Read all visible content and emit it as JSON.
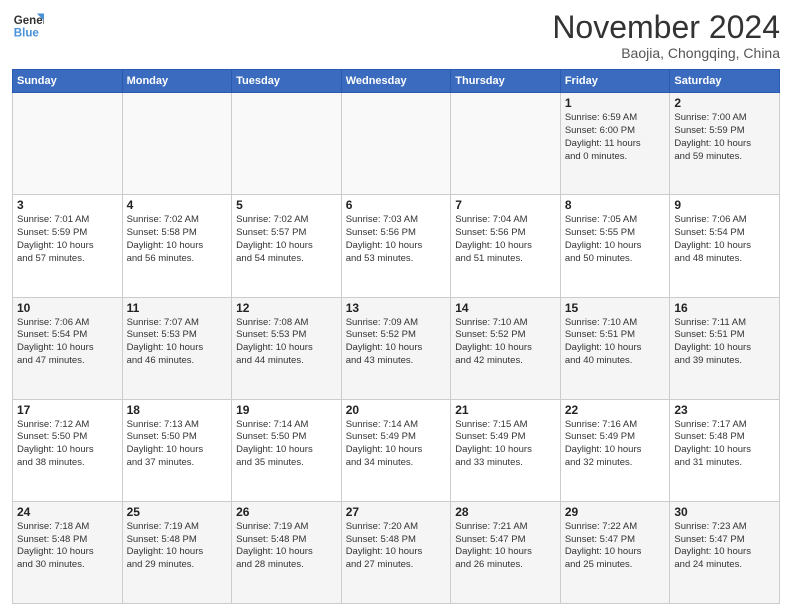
{
  "header": {
    "logo_line1": "General",
    "logo_line2": "Blue",
    "month": "November 2024",
    "location": "Baojia, Chongqing, China"
  },
  "weekdays": [
    "Sunday",
    "Monday",
    "Tuesday",
    "Wednesday",
    "Thursday",
    "Friday",
    "Saturday"
  ],
  "weeks": [
    [
      {
        "day": "",
        "detail": ""
      },
      {
        "day": "",
        "detail": ""
      },
      {
        "day": "",
        "detail": ""
      },
      {
        "day": "",
        "detail": ""
      },
      {
        "day": "",
        "detail": ""
      },
      {
        "day": "1",
        "detail": "Sunrise: 6:59 AM\nSunset: 6:00 PM\nDaylight: 11 hours\nand 0 minutes."
      },
      {
        "day": "2",
        "detail": "Sunrise: 7:00 AM\nSunset: 5:59 PM\nDaylight: 10 hours\nand 59 minutes."
      }
    ],
    [
      {
        "day": "3",
        "detail": "Sunrise: 7:01 AM\nSunset: 5:59 PM\nDaylight: 10 hours\nand 57 minutes."
      },
      {
        "day": "4",
        "detail": "Sunrise: 7:02 AM\nSunset: 5:58 PM\nDaylight: 10 hours\nand 56 minutes."
      },
      {
        "day": "5",
        "detail": "Sunrise: 7:02 AM\nSunset: 5:57 PM\nDaylight: 10 hours\nand 54 minutes."
      },
      {
        "day": "6",
        "detail": "Sunrise: 7:03 AM\nSunset: 5:56 PM\nDaylight: 10 hours\nand 53 minutes."
      },
      {
        "day": "7",
        "detail": "Sunrise: 7:04 AM\nSunset: 5:56 PM\nDaylight: 10 hours\nand 51 minutes."
      },
      {
        "day": "8",
        "detail": "Sunrise: 7:05 AM\nSunset: 5:55 PM\nDaylight: 10 hours\nand 50 minutes."
      },
      {
        "day": "9",
        "detail": "Sunrise: 7:06 AM\nSunset: 5:54 PM\nDaylight: 10 hours\nand 48 minutes."
      }
    ],
    [
      {
        "day": "10",
        "detail": "Sunrise: 7:06 AM\nSunset: 5:54 PM\nDaylight: 10 hours\nand 47 minutes."
      },
      {
        "day": "11",
        "detail": "Sunrise: 7:07 AM\nSunset: 5:53 PM\nDaylight: 10 hours\nand 46 minutes."
      },
      {
        "day": "12",
        "detail": "Sunrise: 7:08 AM\nSunset: 5:53 PM\nDaylight: 10 hours\nand 44 minutes."
      },
      {
        "day": "13",
        "detail": "Sunrise: 7:09 AM\nSunset: 5:52 PM\nDaylight: 10 hours\nand 43 minutes."
      },
      {
        "day": "14",
        "detail": "Sunrise: 7:10 AM\nSunset: 5:52 PM\nDaylight: 10 hours\nand 42 minutes."
      },
      {
        "day": "15",
        "detail": "Sunrise: 7:10 AM\nSunset: 5:51 PM\nDaylight: 10 hours\nand 40 minutes."
      },
      {
        "day": "16",
        "detail": "Sunrise: 7:11 AM\nSunset: 5:51 PM\nDaylight: 10 hours\nand 39 minutes."
      }
    ],
    [
      {
        "day": "17",
        "detail": "Sunrise: 7:12 AM\nSunset: 5:50 PM\nDaylight: 10 hours\nand 38 minutes."
      },
      {
        "day": "18",
        "detail": "Sunrise: 7:13 AM\nSunset: 5:50 PM\nDaylight: 10 hours\nand 37 minutes."
      },
      {
        "day": "19",
        "detail": "Sunrise: 7:14 AM\nSunset: 5:50 PM\nDaylight: 10 hours\nand 35 minutes."
      },
      {
        "day": "20",
        "detail": "Sunrise: 7:14 AM\nSunset: 5:49 PM\nDaylight: 10 hours\nand 34 minutes."
      },
      {
        "day": "21",
        "detail": "Sunrise: 7:15 AM\nSunset: 5:49 PM\nDaylight: 10 hours\nand 33 minutes."
      },
      {
        "day": "22",
        "detail": "Sunrise: 7:16 AM\nSunset: 5:49 PM\nDaylight: 10 hours\nand 32 minutes."
      },
      {
        "day": "23",
        "detail": "Sunrise: 7:17 AM\nSunset: 5:48 PM\nDaylight: 10 hours\nand 31 minutes."
      }
    ],
    [
      {
        "day": "24",
        "detail": "Sunrise: 7:18 AM\nSunset: 5:48 PM\nDaylight: 10 hours\nand 30 minutes."
      },
      {
        "day": "25",
        "detail": "Sunrise: 7:19 AM\nSunset: 5:48 PM\nDaylight: 10 hours\nand 29 minutes."
      },
      {
        "day": "26",
        "detail": "Sunrise: 7:19 AM\nSunset: 5:48 PM\nDaylight: 10 hours\nand 28 minutes."
      },
      {
        "day": "27",
        "detail": "Sunrise: 7:20 AM\nSunset: 5:48 PM\nDaylight: 10 hours\nand 27 minutes."
      },
      {
        "day": "28",
        "detail": "Sunrise: 7:21 AM\nSunset: 5:47 PM\nDaylight: 10 hours\nand 26 minutes."
      },
      {
        "day": "29",
        "detail": "Sunrise: 7:22 AM\nSunset: 5:47 PM\nDaylight: 10 hours\nand 25 minutes."
      },
      {
        "day": "30",
        "detail": "Sunrise: 7:23 AM\nSunset: 5:47 PM\nDaylight: 10 hours\nand 24 minutes."
      }
    ]
  ]
}
